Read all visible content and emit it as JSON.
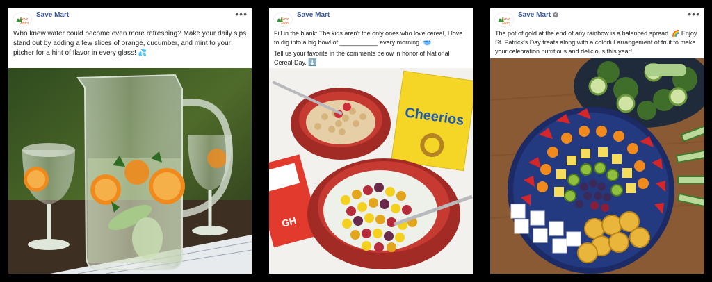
{
  "posts": [
    {
      "brand": "Save Mart",
      "caption": "Who knew water could become even more refreshing? Make your daily sips stand out by adding a few slices of orange, cucumber, and mint to your pitcher for a hint of flavor in every glass!",
      "caption_emoji": "💦",
      "image": "infused-water-pitcher-photo"
    },
    {
      "brand": "Save Mart",
      "caption_line1": "Fill in the blank: The kids aren't the only ones who love cereal, I love to dig into a big bowl of ___________ every morning.",
      "caption_line1_emoji": "🥣",
      "caption_line2": "Tell us your favorite in the comments below in honor of National Cereal Day.",
      "caption_line2_emoji": "⬇️",
      "box_brand": "Cheerios",
      "image": "cereal-bowls-photo"
    },
    {
      "brand": "Save Mart",
      "caption": "The pot of gold at the end of any rainbow is a balanced spread. 🌈 Enjoy St. Patrick's Day treats along with a colorful arrangement of fruit to make your celebration nutritious and delicious this year!",
      "image": "rainbow-fruit-platter-photo"
    }
  ],
  "more_icon": "ellipsis-icon",
  "colors": {
    "brand_blue": "#3b5998",
    "background": "#000000"
  }
}
